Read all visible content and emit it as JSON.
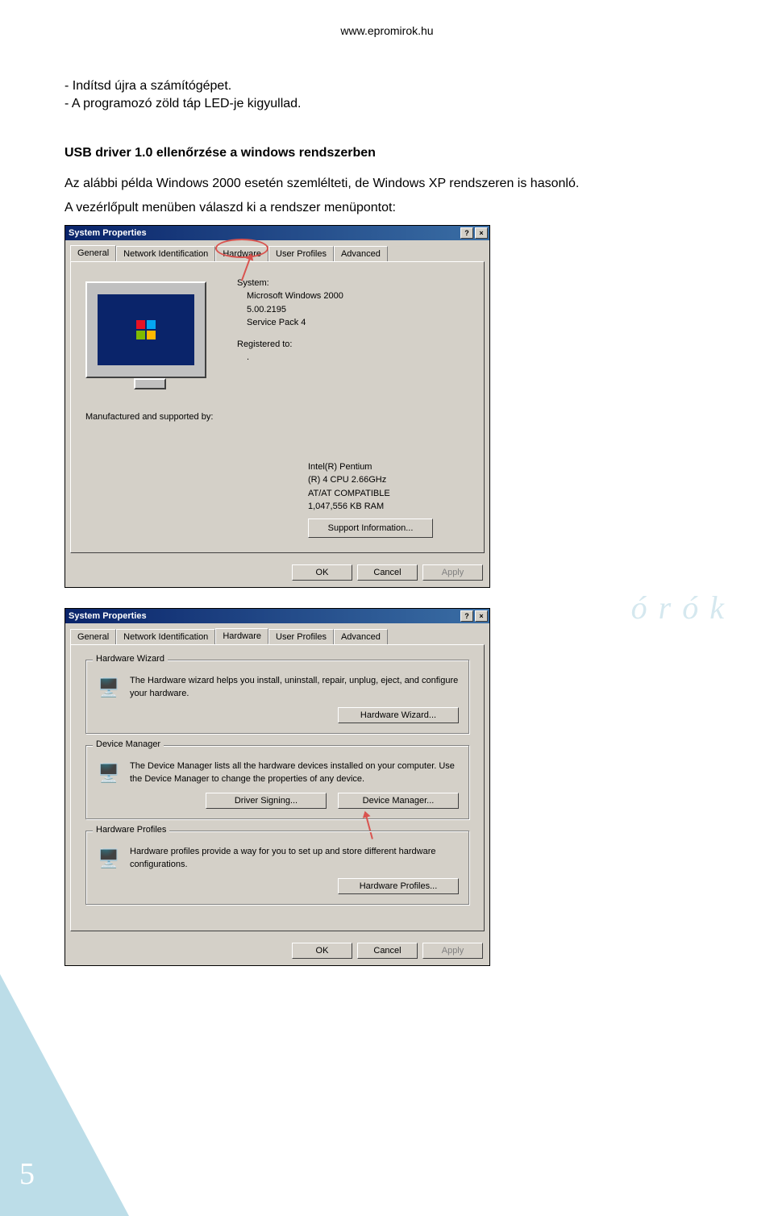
{
  "header": {
    "url": "www.epromirok.hu"
  },
  "intro_lines": {
    "l1": "- Indítsd újra a számítógépet.",
    "l2": "- A programozó zöld táp LED-je kigyullad."
  },
  "section": {
    "title": "USB driver 1.0 ellenőrzése a windows rendszerben",
    "desc1": "Az alábbi példa Windows 2000 esetén szemlélteti, de Windows XP rendszeren is hasonló.",
    "desc2": "A vezérlőpult menüben válaszd ki a rendszer menüpontot:"
  },
  "dialog1": {
    "title": "System Properties",
    "help_btn": "?",
    "close_btn": "×",
    "tabs": {
      "general": "General",
      "netid": "Network Identification",
      "hardware": "Hardware",
      "profiles": "User Profiles",
      "advanced": "Advanced"
    },
    "system_label": "System:",
    "system_os": "Microsoft Windows 2000",
    "system_ver": "5.00.2195",
    "system_sp": "Service Pack 4",
    "registered_label": "Registered to:",
    "registered_val": ".",
    "manuf_label": "Manufactured and supported by:",
    "cpu1": "Intel(R) Pentium",
    "cpu2": "(R) 4 CPU 2.66GHz",
    "compat": "AT/AT COMPATIBLE",
    "ram": "1,047,556 KB RAM",
    "support_btn": "Support Information...",
    "ok": "OK",
    "cancel": "Cancel",
    "apply": "Apply"
  },
  "dialog2": {
    "title": "System Properties",
    "help_btn": "?",
    "close_btn": "×",
    "tabs": {
      "general": "General",
      "netid": "Network Identification",
      "hardware": "Hardware",
      "profiles": "User Profiles",
      "advanced": "Advanced"
    },
    "hw_wizard": {
      "legend": "Hardware Wizard",
      "text": "The Hardware wizard helps you install, uninstall, repair, unplug, eject, and configure your hardware.",
      "btn": "Hardware Wizard..."
    },
    "dev_mgr": {
      "legend": "Device Manager",
      "text": "The Device Manager lists all the hardware devices installed on your computer. Use the Device Manager to change the properties of any device.",
      "btn_sign": "Driver Signing...",
      "btn_mgr": "Device Manager..."
    },
    "hw_profiles": {
      "legend": "Hardware Profiles",
      "text": "Hardware profiles provide a way for you to set up and store different hardware configurations.",
      "btn": "Hardware Profiles..."
    },
    "ok": "OK",
    "cancel": "Cancel",
    "apply": "Apply"
  },
  "watermark": "ó r ó k",
  "page_number": "5"
}
